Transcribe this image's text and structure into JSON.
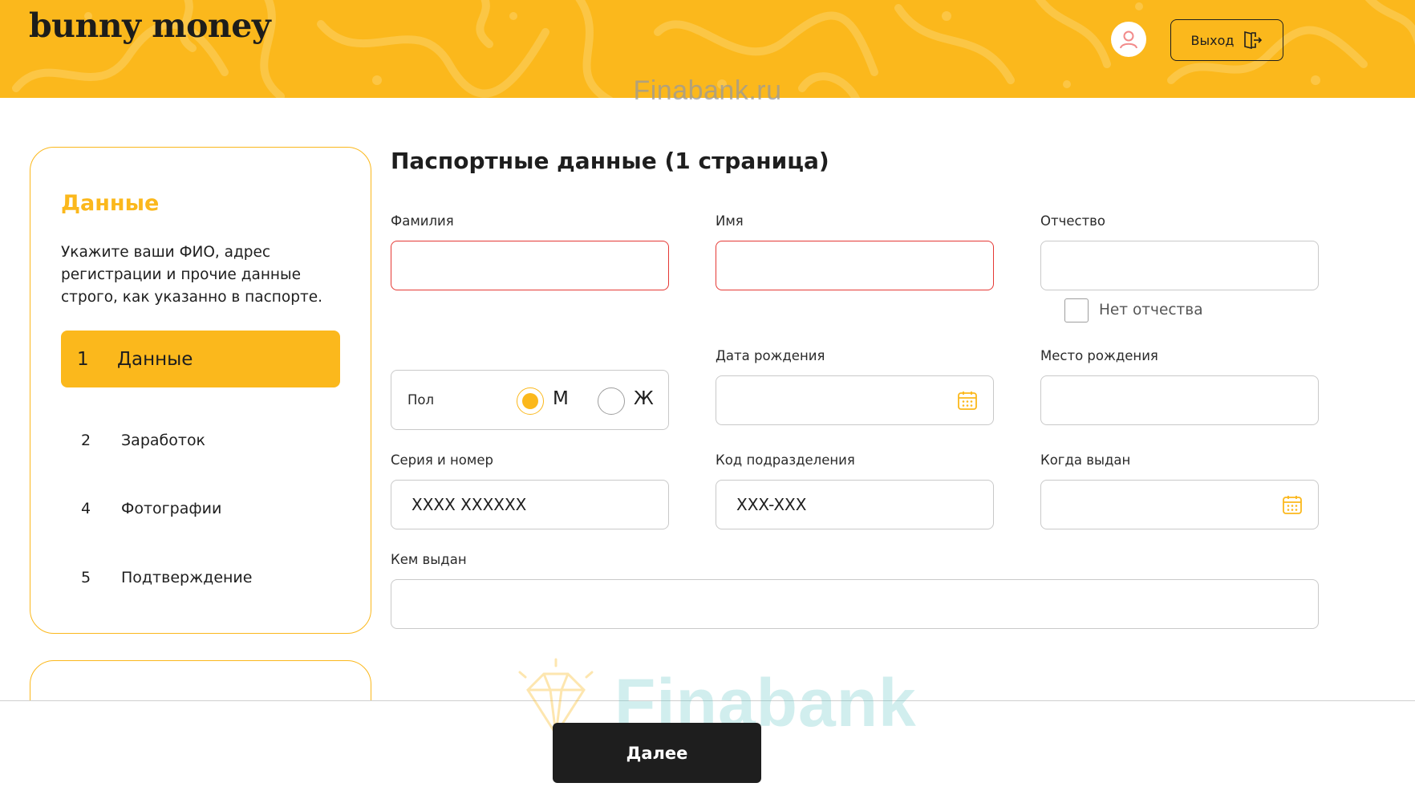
{
  "header": {
    "logo": "bunny money",
    "logout_label": "Выход",
    "watermark": "Finabank.ru"
  },
  "sidebar": {
    "title": "Данные",
    "description": "Укажите ваши ФИО, адрес регистрации и прочие данные строго, как указанно в паспорте.",
    "steps": [
      {
        "num": "1",
        "label": "Данные",
        "active": true
      },
      {
        "num": "2",
        "label": "Заработок",
        "active": false
      },
      {
        "num": "4",
        "label": "Фотографии",
        "active": false
      },
      {
        "num": "5",
        "label": "Подтверждение",
        "active": false
      }
    ]
  },
  "form": {
    "title": "Паспортные данные (1 страница)",
    "lastname": {
      "label": "Фамилия",
      "value": ""
    },
    "firstname": {
      "label": "Имя",
      "value": ""
    },
    "patronymic": {
      "label": "Отчество",
      "value": ""
    },
    "no_patronymic_label": "Нет отчества",
    "gender": {
      "label": "Пол",
      "male": "М",
      "female": "Ж",
      "selected": "М"
    },
    "birth_date": {
      "label": "Дата рождения",
      "value": ""
    },
    "birth_place": {
      "label": "Место рождения",
      "value": ""
    },
    "series_number": {
      "label": "Серия и номер",
      "placeholder": "XXXX XXXXXX"
    },
    "division_code": {
      "label": "Код подразделения",
      "placeholder": "XXX-XXX"
    },
    "issue_date": {
      "label": "Когда выдан",
      "value": ""
    },
    "issued_by": {
      "label": "Кем выдан",
      "value": ""
    }
  },
  "footer": {
    "next_label": "Далее",
    "watermark": "Finabank"
  },
  "colors": {
    "accent": "#fbb81c",
    "error": "#e53935",
    "dark": "#1e1e1e"
  }
}
